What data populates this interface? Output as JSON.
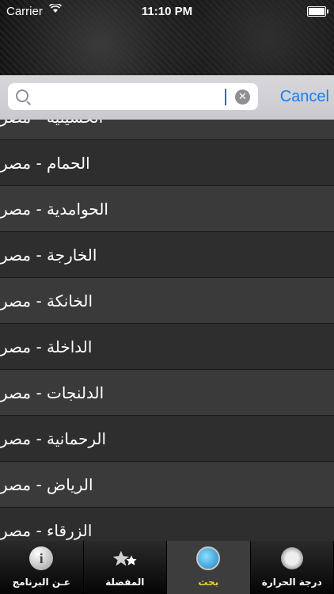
{
  "status": {
    "carrier": "Carrier",
    "time": "11:10 PM",
    "battery_level": 1.0
  },
  "search": {
    "value": "",
    "placeholder": "",
    "clear_icon": "clear-icon",
    "cancel_label": "Cancel"
  },
  "results": [
    "الحسينية - مصر",
    "الحمام - مصر",
    "الحوامدية - مصر",
    "الخارجة - مصر",
    "الخانكة - مصر",
    "الداخلة - مصر",
    "الدلنجات - مصر",
    "الرحمانية - مصر",
    "الرياض - مصر",
    "الزرقاء - مصر"
  ],
  "tabs": [
    {
      "label": "عـن البرنامج",
      "icon": "info-icon"
    },
    {
      "label": "المفضلة",
      "icon": "stars-icon"
    },
    {
      "label": "بحث",
      "icon": "search-globe-icon",
      "selected": true
    },
    {
      "label": "درجة الحرارة",
      "icon": "weather-icon"
    }
  ]
}
